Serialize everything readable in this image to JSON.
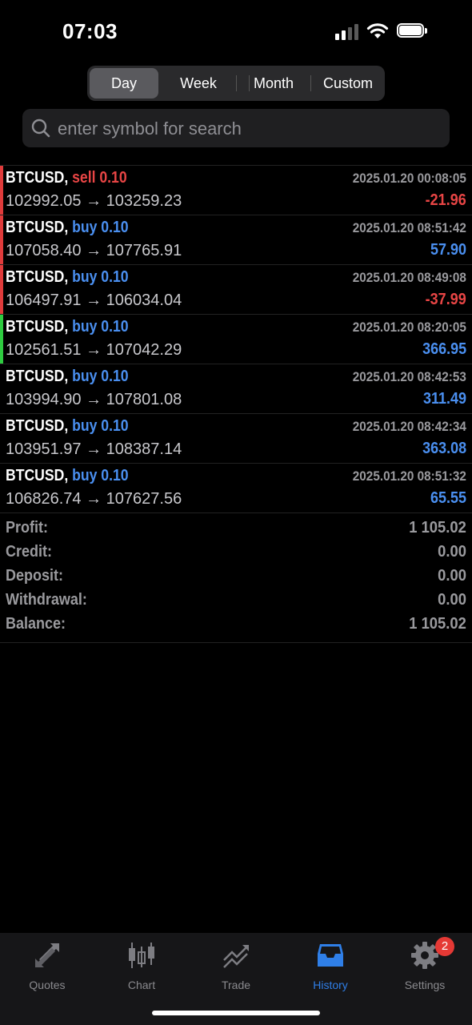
{
  "status": {
    "time": "07:03"
  },
  "periods": [
    {
      "label": "Day",
      "active": true
    },
    {
      "label": "Week",
      "active": false
    },
    {
      "label": "Month",
      "active": false
    },
    {
      "label": "Custom",
      "active": false
    }
  ],
  "search": {
    "placeholder": "enter symbol for search",
    "value": ""
  },
  "colors": {
    "buy": "#4a8ff0",
    "sell": "#e84545",
    "positive": "#4a8ff0",
    "negative": "#e84545",
    "marker_red": "#e03b3b",
    "marker_green": "#2ecc40"
  },
  "deals": [
    {
      "symbol": "BTCUSD,",
      "side": "sell 0.10",
      "sell": true,
      "time": "2025.01.20 00:08:05",
      "open": "102992.05",
      "arrow": "→",
      "close": "103259.23",
      "profit": "-21.96",
      "negative": true,
      "marker": "red"
    },
    {
      "symbol": "BTCUSD,",
      "side": "buy 0.10",
      "sell": false,
      "time": "2025.01.20 08:51:42",
      "open": "107058.40",
      "arrow": "→",
      "close": "107765.91",
      "profit": "57.90",
      "negative": false,
      "marker": "red"
    },
    {
      "symbol": "BTCUSD,",
      "side": "buy 0.10",
      "sell": false,
      "time": "2025.01.20 08:49:08",
      "open": "106497.91",
      "arrow": "→",
      "close": "106034.04",
      "profit": "-37.99",
      "negative": true,
      "marker": "red"
    },
    {
      "symbol": "BTCUSD,",
      "side": "buy 0.10",
      "sell": false,
      "time": "2025.01.20 08:20:05",
      "open": "102561.51",
      "arrow": "→",
      "close": "107042.29",
      "profit": "366.95",
      "negative": false,
      "marker": "green"
    },
    {
      "symbol": "BTCUSD,",
      "side": "buy 0.10",
      "sell": false,
      "time": "2025.01.20 08:42:53",
      "open": "103994.90",
      "arrow": "→",
      "close": "107801.08",
      "profit": "311.49",
      "negative": false,
      "marker": "none"
    },
    {
      "symbol": "BTCUSD,",
      "side": "buy 0.10",
      "sell": false,
      "time": "2025.01.20 08:42:34",
      "open": "103951.97",
      "arrow": "→",
      "close": "108387.14",
      "profit": "363.08",
      "negative": false,
      "marker": "none"
    },
    {
      "symbol": "BTCUSD,",
      "side": "buy 0.10",
      "sell": false,
      "time": "2025.01.20 08:51:32",
      "open": "106826.74",
      "arrow": "→",
      "close": "107627.56",
      "profit": "65.55",
      "negative": false,
      "marker": "none"
    }
  ],
  "summary": [
    {
      "label": "Profit:",
      "value": "1 105.02"
    },
    {
      "label": "Credit:",
      "value": "0.00"
    },
    {
      "label": "Deposit:",
      "value": "0.00"
    },
    {
      "label": "Withdrawal:",
      "value": "0.00"
    },
    {
      "label": "Balance:",
      "value": "1 105.02"
    }
  ],
  "tabs": [
    {
      "label": "Quotes",
      "icon": "quotes-icon",
      "active": false
    },
    {
      "label": "Chart",
      "icon": "chart-icon",
      "active": false
    },
    {
      "label": "Trade",
      "icon": "trade-icon",
      "active": false
    },
    {
      "label": "History",
      "icon": "history-icon",
      "active": true
    },
    {
      "label": "Settings",
      "icon": "gear-icon",
      "active": false,
      "badge": "2"
    }
  ]
}
